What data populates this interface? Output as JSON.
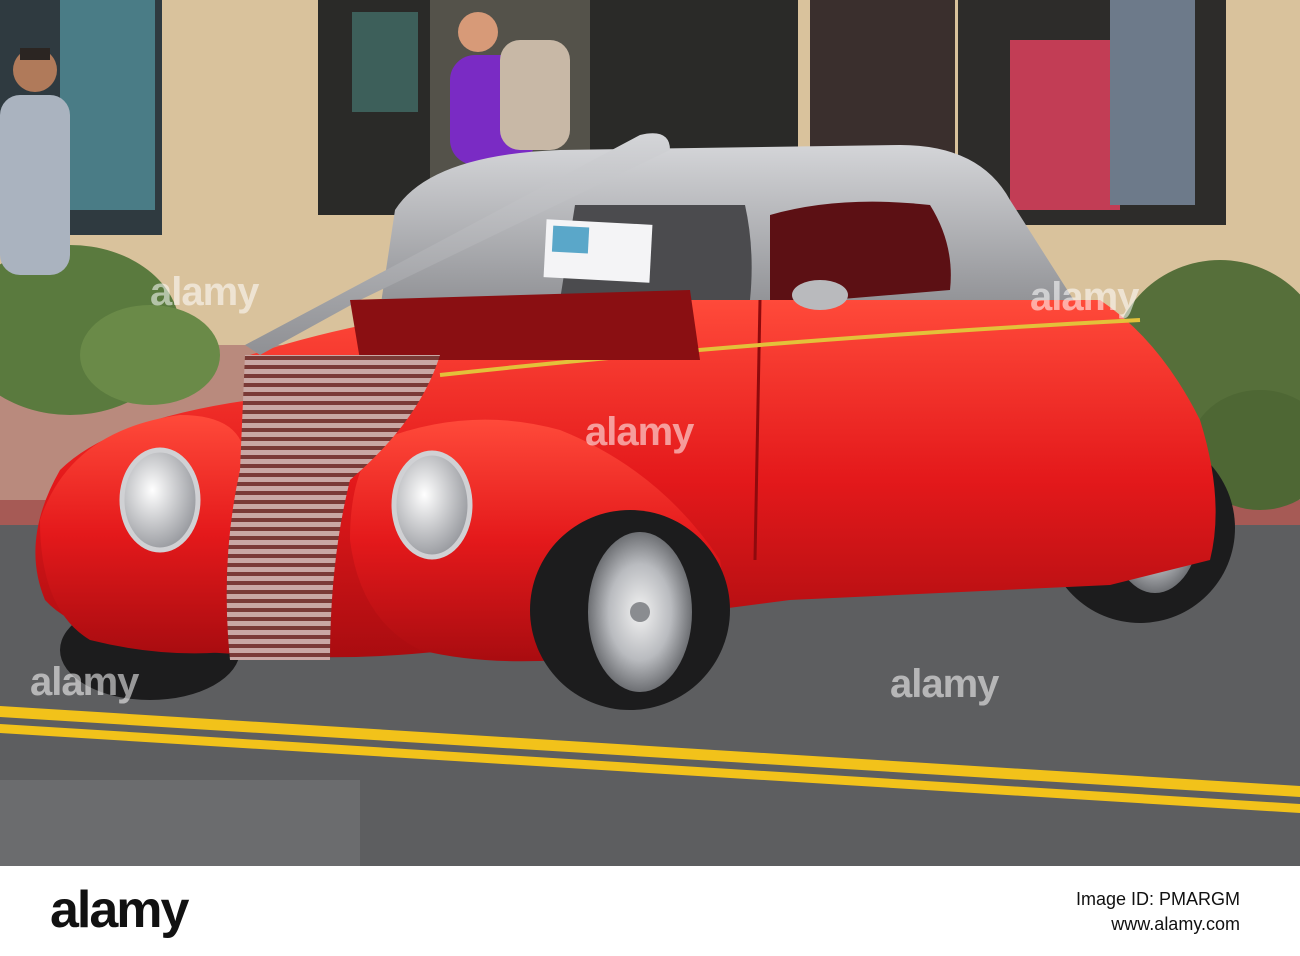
{
  "watermark": {
    "text": "alamy"
  },
  "footer": {
    "logo_text": "alamy",
    "image_id_label": "Image ID: PMARGM",
    "url": "www.alamy.com"
  },
  "scene": {
    "subject": "red-hot-rod-coupe",
    "colors": {
      "car_body": "#e4191b",
      "car_roof": "#a9aaad",
      "road": "#5d5e60",
      "road_line": "#f2c21a",
      "building": "#d9c29c",
      "shrub": "#5a7a3e"
    }
  }
}
